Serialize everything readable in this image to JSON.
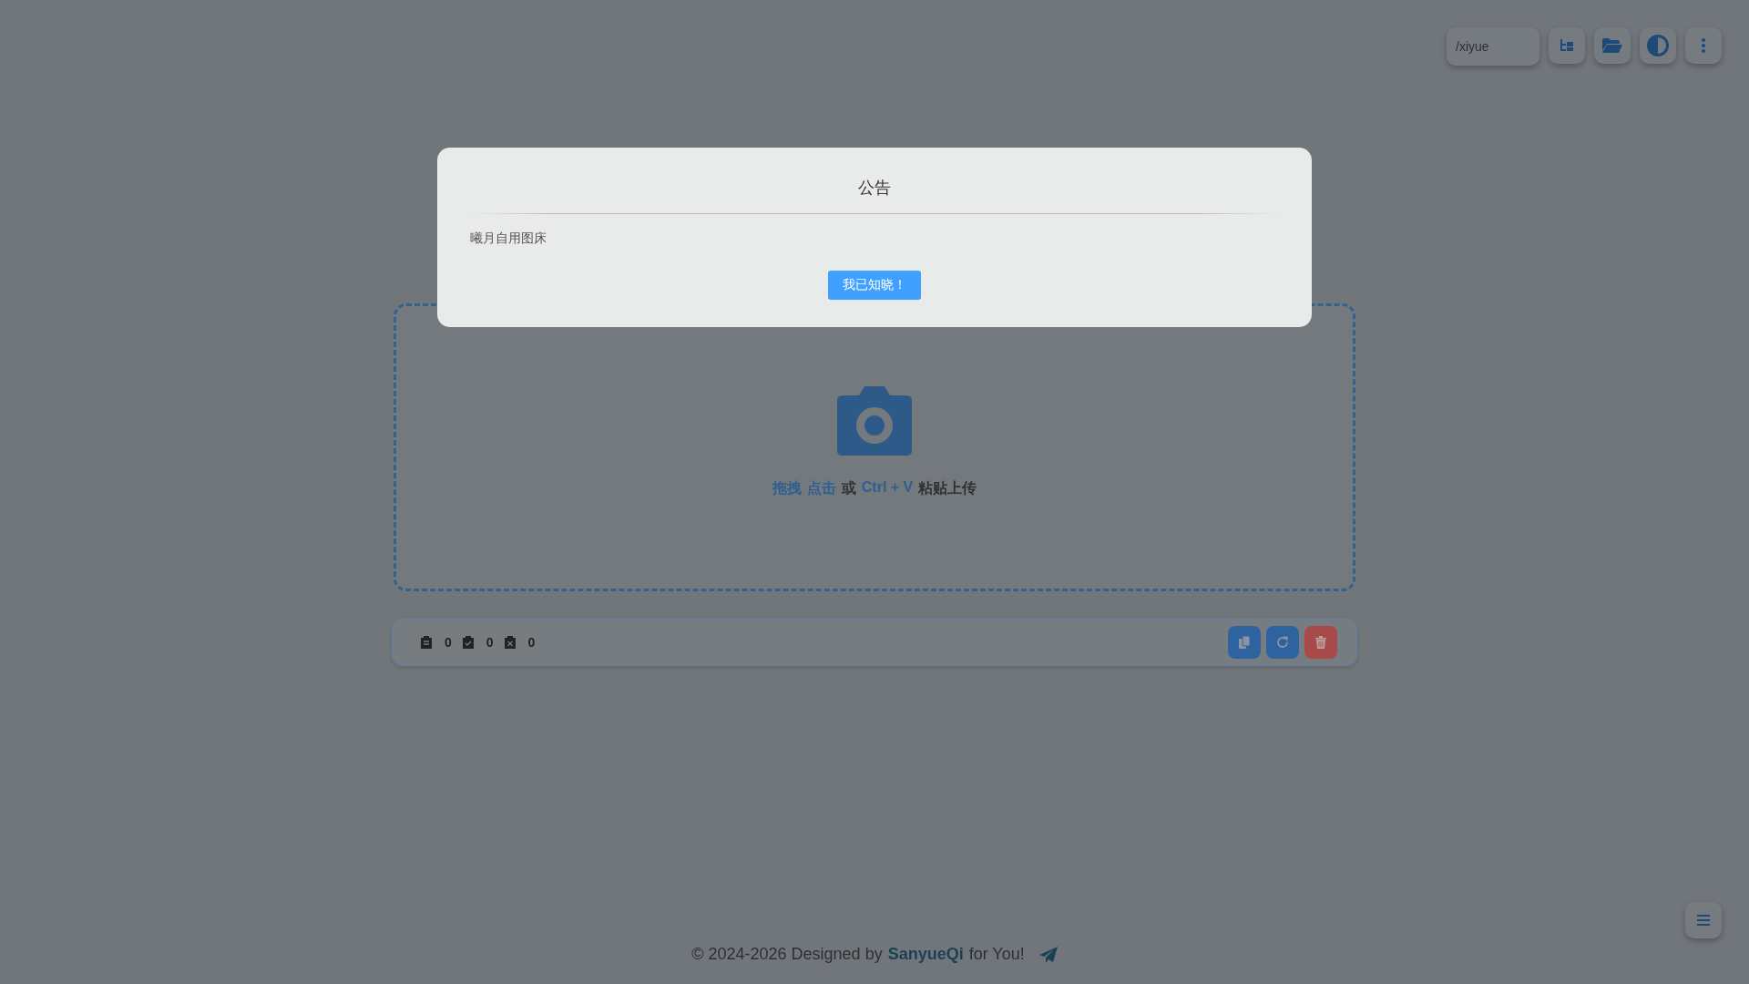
{
  "toolbar": {
    "path_field": {
      "value": "/xiyue"
    },
    "buttons": [
      {
        "kind": "tree"
      },
      {
        "kind": "folder"
      },
      {
        "kind": "contrast"
      },
      {
        "kind": "more"
      }
    ]
  },
  "upload": {
    "hint": [
      {
        "text": "拖拽",
        "kind": "link"
      },
      {
        "text": "点击",
        "kind": "link"
      },
      {
        "text": "或",
        "kind": "plain"
      },
      {
        "text": "Ctrl + V",
        "kind": "link"
      },
      {
        "text": "粘贴上传",
        "kind": "plain"
      }
    ]
  },
  "stats": [
    {
      "kind": "total",
      "count": "0"
    },
    {
      "kind": "done",
      "count": "0"
    },
    {
      "kind": "failed",
      "count": "0"
    }
  ],
  "actions": [
    {
      "kind": "copy"
    },
    {
      "kind": "refresh"
    },
    {
      "kind": "delete"
    }
  ],
  "footer": {
    "before": "© 2024-2026 Designed by",
    "author": "SanyueQi",
    "after": "for You!"
  },
  "notice": {
    "title": "公告",
    "body": "曦月自用图床",
    "button": "我已知晓！"
  }
}
